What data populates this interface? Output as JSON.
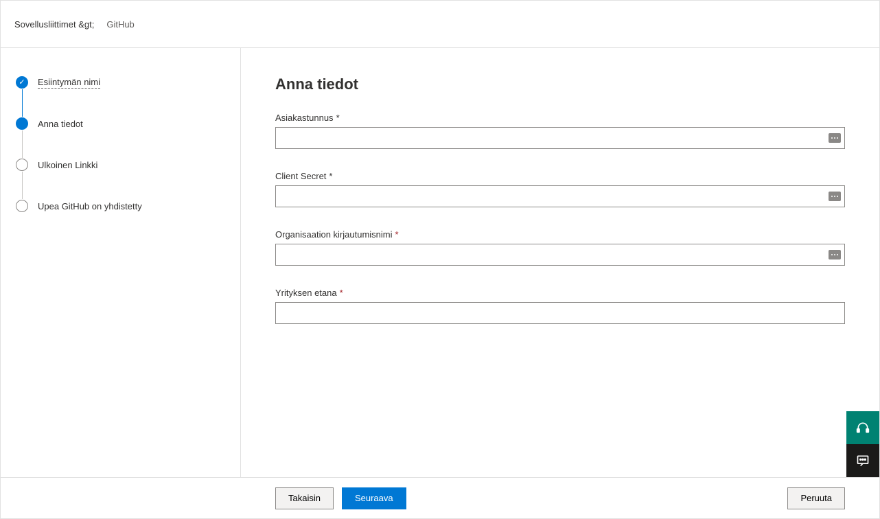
{
  "breadcrumb": {
    "parent": "Sovellusliittimet &gt;",
    "current": "GitHub"
  },
  "steps": [
    {
      "label": "Esiintymän nimi",
      "state": "completed"
    },
    {
      "label": "Anna tiedot",
      "state": "current"
    },
    {
      "label": "Ulkoinen Linkki",
      "state": "pending"
    },
    {
      "label": "Upea GitHub on yhdistetty",
      "state": "pending"
    }
  ],
  "main": {
    "title": "Anna tiedot",
    "fields": [
      {
        "label": "Asiakastunnus",
        "required": true,
        "reqStyle": "dark",
        "hasSuffix": true
      },
      {
        "label": "Client Secret",
        "required": true,
        "reqStyle": "dark",
        "hasSuffix": true
      },
      {
        "label": "Organisaation kirjautumisnimi",
        "required": true,
        "reqStyle": "red",
        "hasSuffix": true
      },
      {
        "label": "Yrityksen etana",
        "required": true,
        "reqStyle": "red",
        "hasSuffix": false
      }
    ]
  },
  "footer": {
    "back": "Takaisin",
    "next": "Seuraava",
    "cancel": "Peruuta"
  }
}
